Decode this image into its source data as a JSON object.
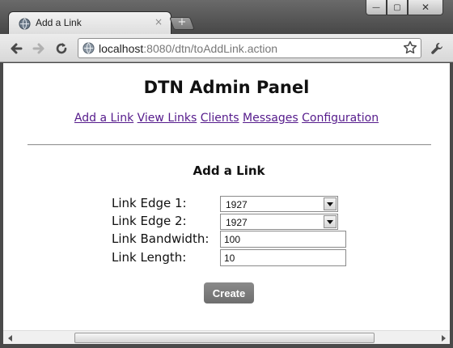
{
  "browser": {
    "tab_title": "Add a Link",
    "tab_close": "×",
    "new_tab": "+",
    "url_host": "localhost",
    "url_path": ":8080/dtn/toAddLink.action",
    "window_buttons": {
      "minimize": "—",
      "maximize": "▢",
      "close": "✕"
    }
  },
  "page": {
    "title": "DTN Admin Panel",
    "nav": [
      "Add a Link",
      "View Links",
      "Clients",
      "Messages",
      "Configuration"
    ],
    "form_title": "Add a Link",
    "fields": {
      "edge1": {
        "label": "Link Edge 1:",
        "value": "1927"
      },
      "edge2": {
        "label": "Link Edge 2:",
        "value": "1927"
      },
      "bandwidth": {
        "label": "Link Bandwidth:",
        "value": "100"
      },
      "length": {
        "label": "Link Length:",
        "value": "10"
      }
    },
    "create_label": "Create"
  },
  "colors": {
    "link": "#551a8b",
    "button": "#7a7a7a",
    "chrome_dark": "#4a4a4a"
  },
  "icons": [
    "globe-icon",
    "back-icon",
    "forward-icon",
    "reload-icon",
    "star-icon",
    "wrench-icon",
    "scroll-left-icon",
    "scroll-right-icon"
  ]
}
